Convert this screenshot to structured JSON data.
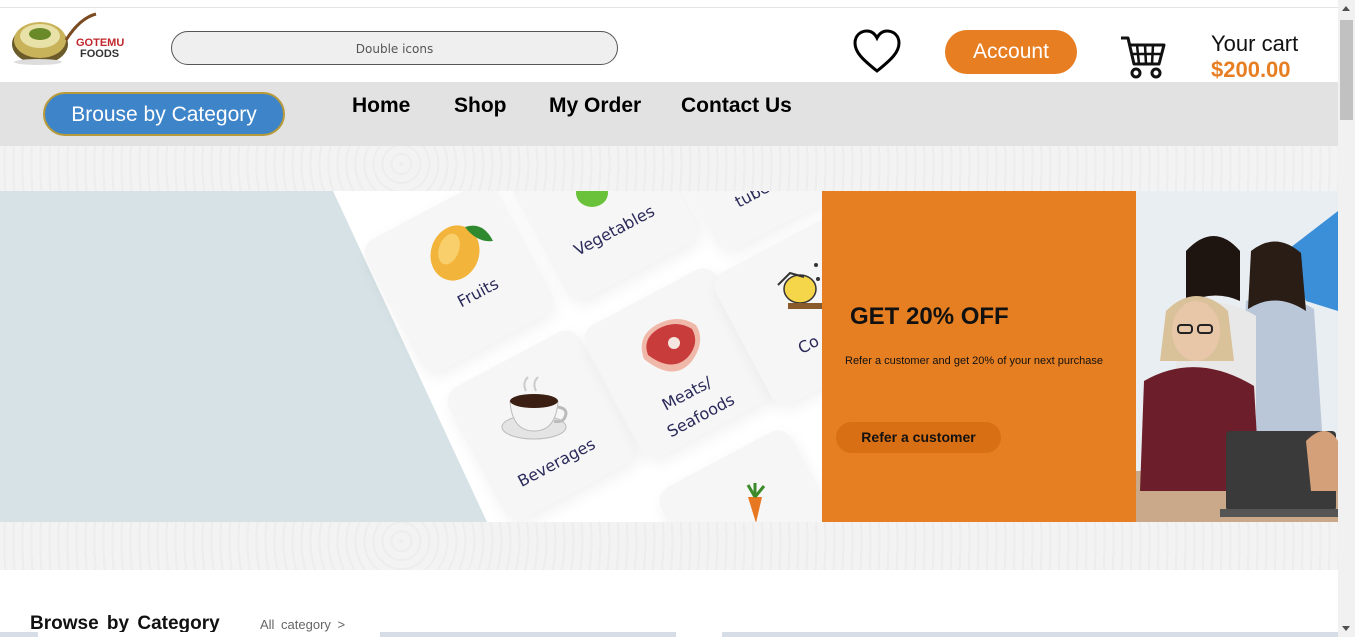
{
  "brand": {
    "line1": "GOTEMU",
    "line2": "FOODS"
  },
  "search": {
    "placeholder": "Double icons"
  },
  "header": {
    "account_label": "Account",
    "cart_label": "Your cart",
    "cart_total": "$200.00"
  },
  "nav": {
    "browse_label": "Brouse by Category",
    "links": [
      "Home",
      "Shop",
      "My Order",
      "Contact Us"
    ]
  },
  "hero": {
    "categories": [
      "Fruits",
      "Vegetables",
      "tube",
      "Meats/",
      "Seafoods",
      "Beverages",
      "Co"
    ]
  },
  "promo": {
    "title": "GET 20% OFF",
    "text": "Refer a customer and get 20% of your next purchase",
    "button": "Refer a customer"
  },
  "section": {
    "title": "Browse  by  Category",
    "all_link": "All  category  >"
  },
  "colors": {
    "accent": "#e87e22",
    "blue": "#3e84c8",
    "navbar": "#e2e2e2",
    "hero_blue": "#d6e2e5"
  }
}
